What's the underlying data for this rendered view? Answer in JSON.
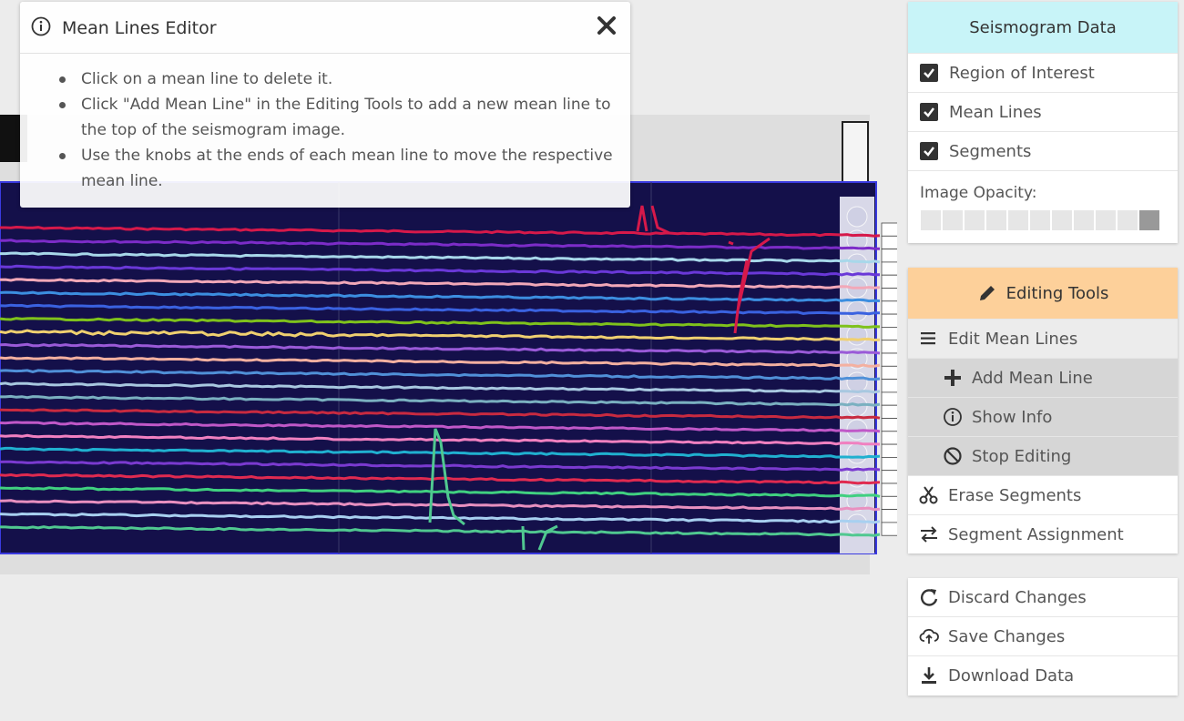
{
  "popup": {
    "title": "Mean Lines Editor",
    "bullets": [
      "Click on a mean line to delete it.",
      "Click \"Add Mean Line\" in the Editing Tools to add a new mean line to the top of the seismogram image.",
      "Use the knobs at the ends of each mean line to move the respective mean line."
    ]
  },
  "seismogram_panel": {
    "header": "Seismogram Data",
    "header_color": "#c8f4f8",
    "items": [
      {
        "label": "Region of Interest",
        "checked": true
      },
      {
        "label": "Mean Lines",
        "checked": true
      },
      {
        "label": "Segments",
        "checked": true
      }
    ],
    "opacity_label": "Image Opacity:",
    "opacity_level": 1.0
  },
  "editing_panel": {
    "header": "Editing Tools",
    "header_color": "#fdd09a",
    "items": [
      {
        "label": "Edit Mean Lines",
        "icon": "menu-icon"
      },
      {
        "label": "Add Mean Line",
        "icon": "plus-icon"
      },
      {
        "label": "Show Info",
        "icon": "info-icon"
      },
      {
        "label": "Stop Editing",
        "icon": "ban-icon"
      },
      {
        "label": "Erase Segments",
        "icon": "scissors-icon"
      },
      {
        "label": "Segment Assignment",
        "icon": "exchange-icon"
      }
    ]
  },
  "actions_panel": {
    "items": [
      {
        "label": "Discard Changes",
        "icon": "undo-icon"
      },
      {
        "label": "Save Changes",
        "icon": "cloud-upload-icon"
      },
      {
        "label": "Download Data",
        "icon": "download-icon"
      }
    ]
  },
  "trace_colors": [
    "#d6194a",
    "#7c2cc8",
    "#a8d8ea",
    "#6a38d8",
    "#f2a8b8",
    "#3c8ee0",
    "#3a62e0",
    "#7fc21c",
    "#f0d070",
    "#9a5ad8",
    "#f4b0a0",
    "#5090d8",
    "#a8c8e0",
    "#7ab0c0",
    "#c82a40",
    "#c058c8",
    "#f080c0",
    "#20b0d0",
    "#7a3ad0",
    "#e02a50",
    "#40d080",
    "#e890c0",
    "#a8d0f0",
    "#50c890"
  ]
}
